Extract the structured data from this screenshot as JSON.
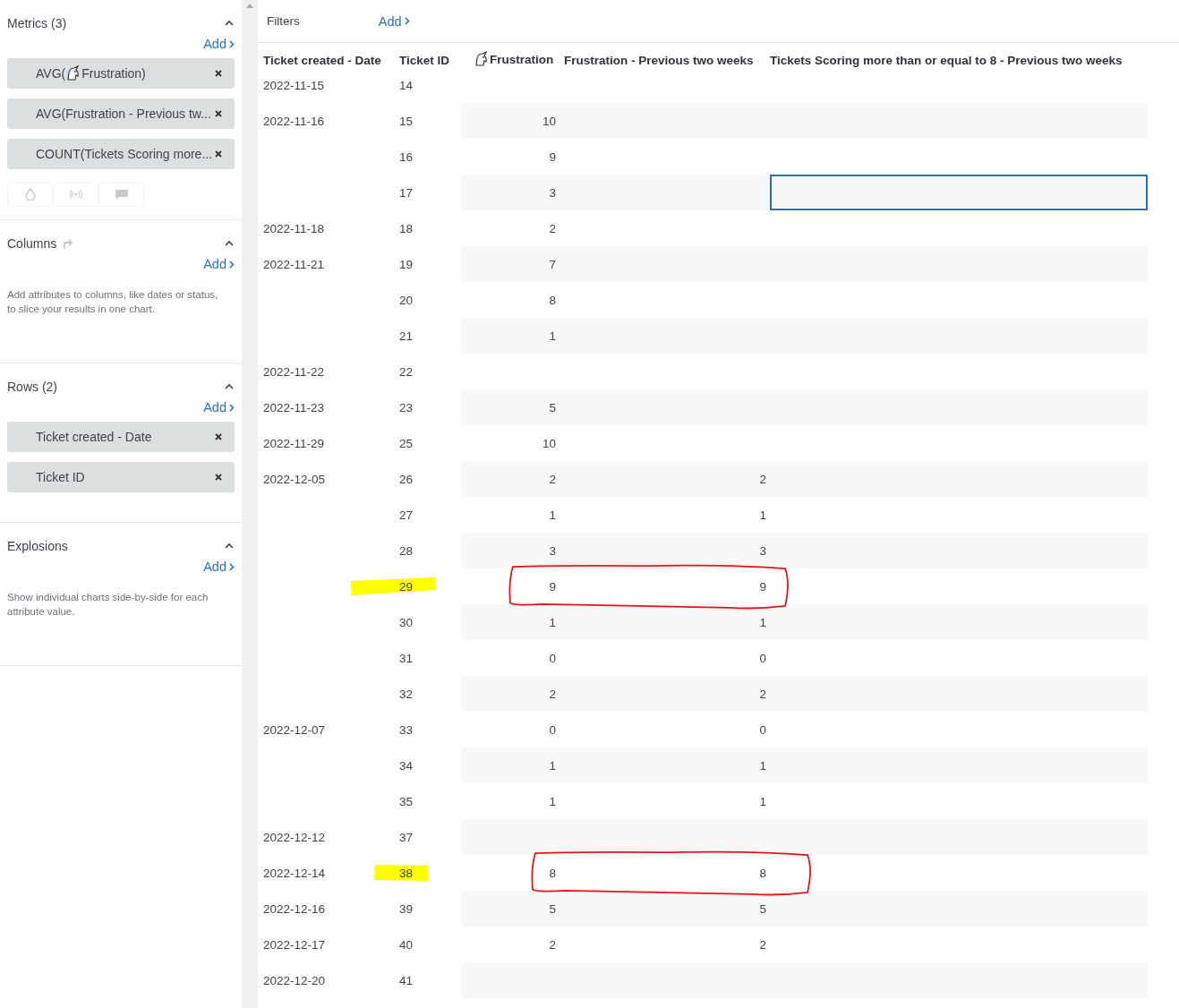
{
  "sidebar": {
    "sections": [
      {
        "kind": "metrics",
        "title": "Metrics (3)",
        "expanded": true,
        "add": "Add",
        "items": [
          {
            "label": "AVG(",
            "icon": true,
            "label_after": "Frustration)"
          },
          {
            "label": "AVG(Frustration - Previous tw...",
            "icon": false
          },
          {
            "label": "COUNT(Tickets Scoring more...",
            "icon": false
          }
        ],
        "tools_disabled": true
      },
      {
        "kind": "columns",
        "title": "Columns",
        "expanded": true,
        "add": "Add",
        "description": "Add attributes to columns, like dates or status, to slice your results in one chart."
      },
      {
        "kind": "rows",
        "title": "Rows (2)",
        "expanded": true,
        "add": "Add",
        "items": [
          {
            "label": "Ticket created - Date",
            "icon": false
          },
          {
            "label": "Ticket ID",
            "icon": false
          }
        ]
      },
      {
        "kind": "explosions",
        "title": "Explosions",
        "expanded": true,
        "add": "Add",
        "description": "Show individual charts side-by-side for each attribute value."
      }
    ]
  },
  "filters": {
    "label": "Filters",
    "add": "Add"
  },
  "table": {
    "columns": [
      {
        "label": "Ticket created - Date",
        "icon": false
      },
      {
        "label": "Ticket ID",
        "icon": false
      },
      {
        "label": "Frustration",
        "icon": true
      },
      {
        "label": "Frustration - Previous two weeks",
        "icon": false
      },
      {
        "label": "Tickets Scoring more than or equal to 8 - Previous two weeks",
        "icon": false
      }
    ],
    "rows": [
      {
        "date": "2022-11-15",
        "ticket_id": "14",
        "selected": false,
        "highlighted": false,
        "circled": false
      },
      {
        "date": "2022-11-16",
        "ticket_id": "15",
        "frustration": "10",
        "selected": false,
        "highlighted": false,
        "circled": false
      },
      {
        "ticket_id": "16",
        "frustration": "9",
        "selected": false,
        "highlighted": false,
        "circled": false
      },
      {
        "ticket_id": "17",
        "frustration": "3",
        "selected": true,
        "highlighted": false,
        "circled": false
      },
      {
        "date": "2022-11-18",
        "ticket_id": "18",
        "frustration": "2",
        "selected": false,
        "highlighted": false,
        "circled": false
      },
      {
        "date": "2022-11-21",
        "ticket_id": "19",
        "frustration": "7",
        "selected": false,
        "highlighted": false,
        "circled": false
      },
      {
        "ticket_id": "20",
        "frustration": "8",
        "selected": false,
        "highlighted": false,
        "circled": false
      },
      {
        "ticket_id": "21",
        "frustration": "1",
        "selected": false,
        "highlighted": false,
        "circled": false
      },
      {
        "date": "2022-11-22",
        "ticket_id": "22",
        "selected": false,
        "highlighted": false,
        "circled": false
      },
      {
        "date": "2022-11-23",
        "ticket_id": "23",
        "frustration": "5",
        "selected": false,
        "highlighted": false,
        "circled": false
      },
      {
        "date": "2022-11-29",
        "ticket_id": "25",
        "frustration": "10",
        "selected": false,
        "highlighted": false,
        "circled": false
      },
      {
        "date": "2022-12-05",
        "ticket_id": "26",
        "frustration": "2",
        "previous": "2",
        "selected": false,
        "highlighted": false,
        "circled": false
      },
      {
        "ticket_id": "27",
        "frustration": "1",
        "previous": "1",
        "selected": false,
        "highlighted": false,
        "circled": false
      },
      {
        "ticket_id": "28",
        "frustration": "3",
        "previous": "3",
        "selected": false,
        "highlighted": false,
        "circled": false
      },
      {
        "ticket_id": "29",
        "frustration": "9",
        "previous": "9",
        "selected": false,
        "highlighted": true,
        "circled": true
      },
      {
        "ticket_id": "30",
        "frustration": "1",
        "previous": "1",
        "selected": false,
        "highlighted": false,
        "circled": false
      },
      {
        "ticket_id": "31",
        "frustration": "0",
        "previous": "0",
        "selected": false,
        "highlighted": false,
        "circled": false
      },
      {
        "ticket_id": "32",
        "frustration": "2",
        "previous": "2",
        "selected": false,
        "highlighted": false,
        "circled": false
      },
      {
        "date": "2022-12-07",
        "ticket_id": "33",
        "frustration": "0",
        "previous": "0",
        "selected": false,
        "highlighted": false,
        "circled": false
      },
      {
        "ticket_id": "34",
        "frustration": "1",
        "previous": "1",
        "selected": false,
        "highlighted": false,
        "circled": false
      },
      {
        "ticket_id": "35",
        "frustration": "1",
        "previous": "1",
        "selected": false,
        "highlighted": false,
        "circled": false
      },
      {
        "date": "2022-12-12",
        "ticket_id": "37",
        "selected": false,
        "highlighted": false,
        "circled": false
      },
      {
        "date": "2022-12-14",
        "ticket_id": "38",
        "frustration": "8",
        "previous": "8",
        "selected": false,
        "highlighted": true,
        "circled": true
      },
      {
        "date": "2022-12-16",
        "ticket_id": "39",
        "frustration": "5",
        "previous": "5",
        "selected": false,
        "highlighted": false,
        "circled": false
      },
      {
        "date": "2022-12-17",
        "ticket_id": "40",
        "frustration": "2",
        "previous": "2",
        "selected": false,
        "highlighted": false,
        "circled": false
      },
      {
        "date": "2022-12-20",
        "ticket_id": "41",
        "selected": false,
        "highlighted": false,
        "circled": false
      }
    ]
  }
}
